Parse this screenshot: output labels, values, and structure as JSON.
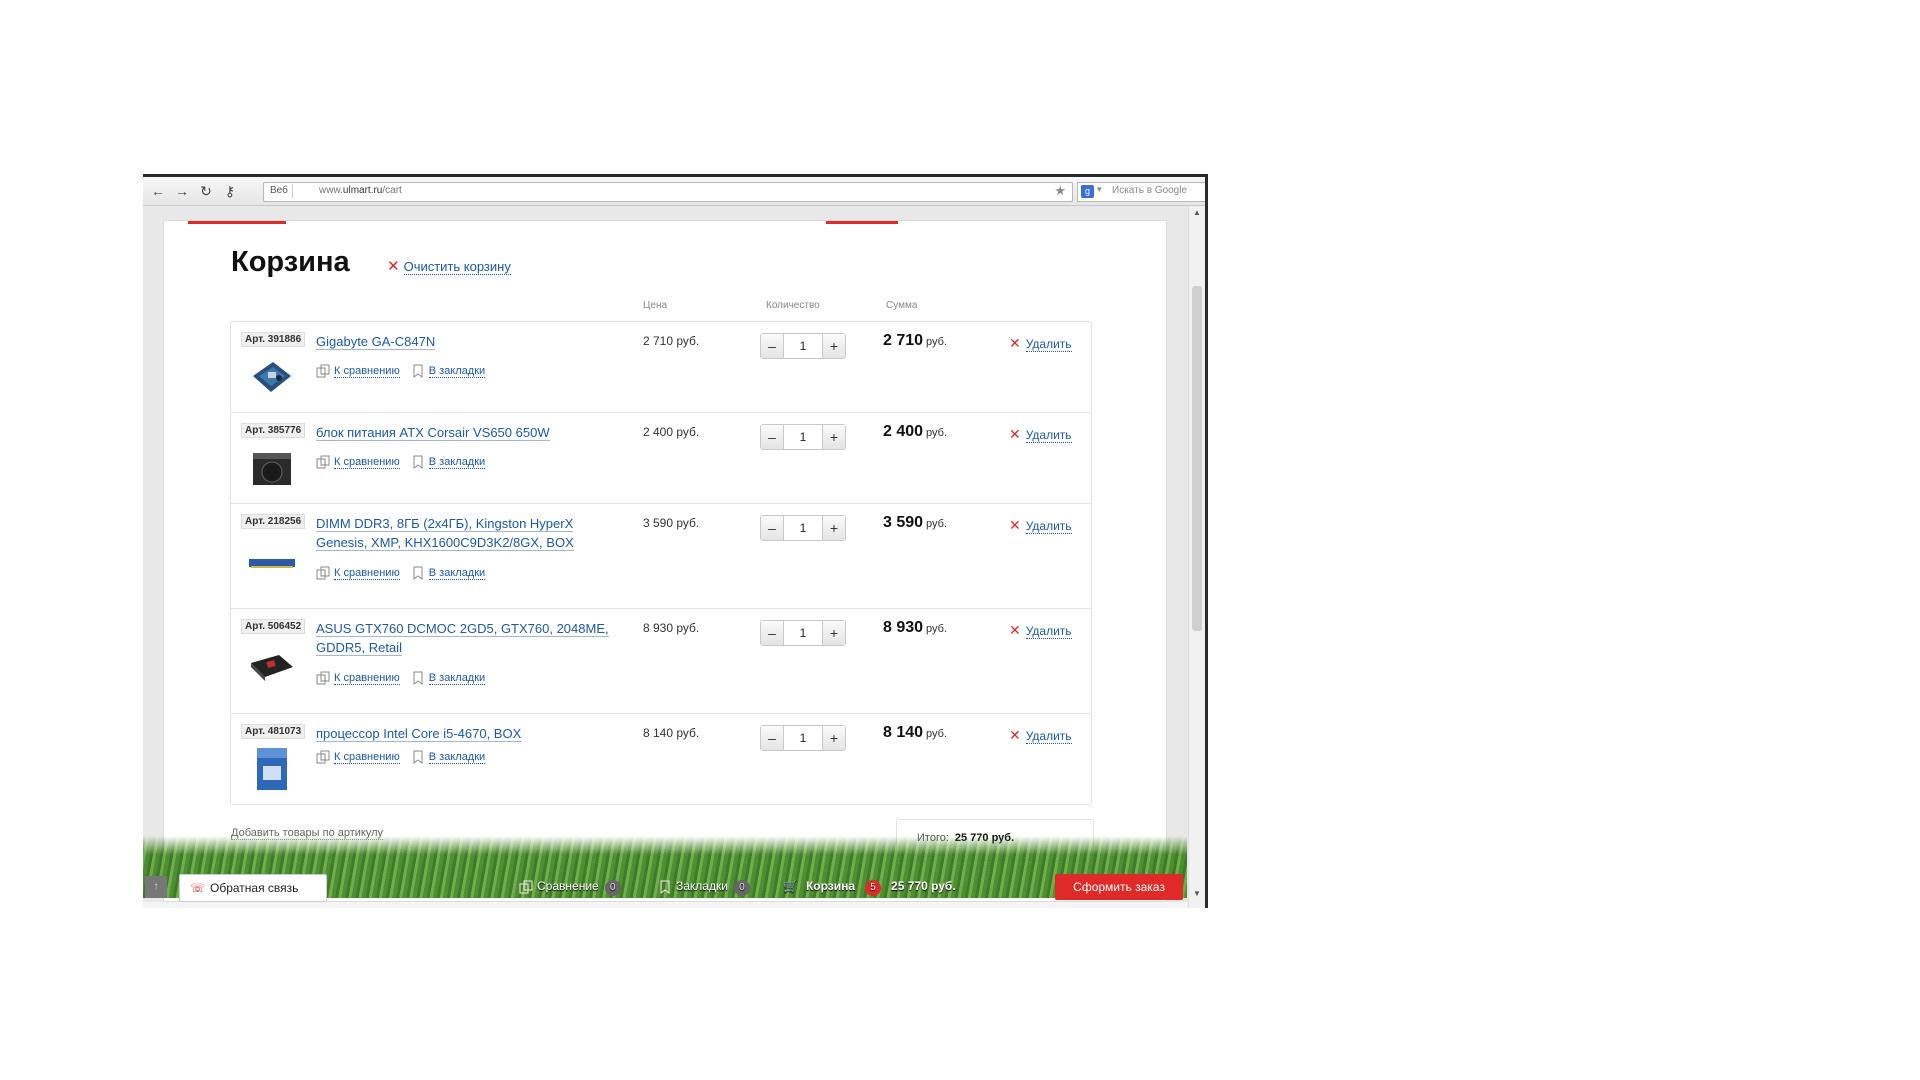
{
  "browser": {
    "site_badge": "Веб",
    "url_prefix": "www.",
    "url_domain": "ulmart.ru",
    "url_path": "/cart",
    "search_placeholder": "Искать в Google"
  },
  "page": {
    "title": "Корзина",
    "clear_cart": "Очистить корзину",
    "columns": {
      "price": "Цена",
      "quantity": "Количество",
      "sum": "Сумма"
    },
    "compare_label": "К сравнению",
    "bookmark_label": "В закладки",
    "delete_label": "Удалить",
    "items": [
      {
        "art": "Арт. 391886",
        "name": "Gigabyte GA-C847N",
        "price": "2 710 руб.",
        "qty": "1",
        "sum": "2 710",
        "currency": "руб."
      },
      {
        "art": "Арт. 385776",
        "name": "блок питания ATX Corsair VS650 650W",
        "price": "2 400 руб.",
        "qty": "1",
        "sum": "2 400",
        "currency": "руб."
      },
      {
        "art": "Арт. 218256",
        "name": "DIMM DDR3, 8ГБ (2x4ГБ), Kingston HyperX Genesis, XMP, KHX1600C9D3K2/8GX, BOX",
        "price": "3 590 руб.",
        "qty": "1",
        "sum": "3 590",
        "currency": "руб."
      },
      {
        "art": "Арт. 506452",
        "name": "ASUS GTX760 DCMOC 2GD5, GTX760, 2048ME, GDDR5, Retail",
        "price": "8 930 руб.",
        "qty": "1",
        "sum": "8 930",
        "currency": "руб."
      },
      {
        "art": "Арт. 481073",
        "name": "процессор Intel Core i5-4670, BOX",
        "price": "8 140 руб.",
        "qty": "1",
        "sum": "8 140",
        "currency": "руб."
      }
    ],
    "add_by_article": "Добавить товары по артикулу",
    "total_label": "Итого:",
    "total_value": "25 770 руб."
  },
  "bottom_bar": {
    "feedback": "Обратная связь",
    "compare": "Сравнение",
    "compare_count": "0",
    "bookmarks": "Закладки",
    "bookmarks_count": "0",
    "cart": "Корзина",
    "cart_count": "5",
    "cart_total": "25 770 руб.",
    "order_button": "Сформить заказ"
  },
  "colors": {
    "accent": "#e02a2a",
    "link": "#1a5aa6"
  }
}
